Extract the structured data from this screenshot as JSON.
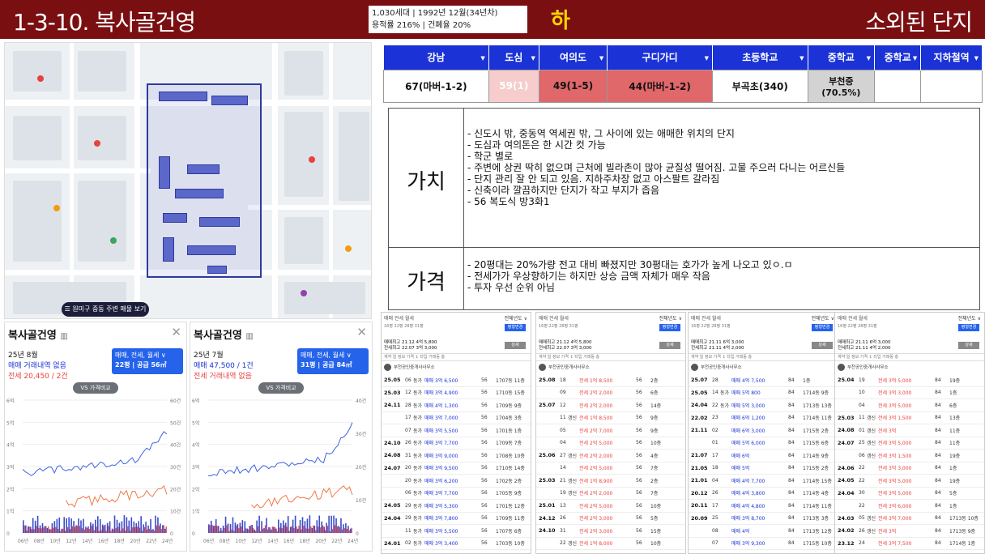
{
  "header": {
    "title": "1-3-10. 복사골건영",
    "info_line1": "1,030세대 | 1992년 12월(34년차)",
    "info_line2": "용적률 216% | 건폐율 20%",
    "grade": "하",
    "tagline": "소외된 단지"
  },
  "map": {
    "button_label": "원미구 중동 주변 매물 보기"
  },
  "score_table": {
    "headers": [
      "강남",
      "도심",
      "여의도",
      "구디가디",
      "초등학교",
      "중학교",
      "중학교",
      "지하철역"
    ],
    "cells": [
      "67(마버-1-2)",
      "59(1)",
      "49(1-5)",
      "44(마버-1-2)",
      "부곡초(340)",
      "부천중\n(70.5%)",
      "",
      ""
    ],
    "colors": [
      "#ffffff",
      "#f6cccc",
      "#e0676a",
      "#e0676a",
      "#ffffff",
      "#d3d3d3",
      "#ffffff",
      "#ffffff"
    ]
  },
  "notes": {
    "value_label": "가치",
    "value_items": [
      "- 신도시 밖, 중동역 역세권 밖, 그 사이에 있는 애매한 위치의 단지",
      "- 도심과 여의돈은 한 시간 컷 가능",
      "- 학군 별로",
      "- 주변에 상권 딱히 없으며 근처에 빌라촌이 많아 균질성 떨어짐. 고물 주으러 다니는 어르신들",
      "- 단지 관리 잘 안 되고 있음. 지하주차장 없고 아스팔트 갈라짐",
      "- 신축이라 깔끔하지만 단지가 작고 부지가 좁음",
      "- 56 복도식 방3화1"
    ],
    "price_label": "가격",
    "price_items": [
      "- 20평대는 20%가량 전고 대비 빠졌지만 30평대는 호가가 높게 나오고 있ㅇ.ㅁ",
      "- 전세가가 우상향하기는 하지만 상승 금액 자체가 매우 작음",
      "- 투자 우선 순위 아님"
    ]
  },
  "charts": [
    {
      "title": "복사골건영",
      "date": "25년 8월",
      "line1": "매매 거래내역 없음",
      "line2": "전세 20,450 / 2건",
      "pill_line1": "매매, 전세, 월세 ∨",
      "pill_line2": "22평 | 공급 56㎡",
      "vs_label": "VS 가격비교",
      "y_left": [
        "6억",
        "5억",
        "4억",
        "3억",
        "2억",
        "1억",
        "0"
      ],
      "y_right": [
        "60건",
        "50건",
        "40건",
        "30건",
        "20건",
        "10건",
        "0"
      ],
      "x_labels": [
        "06년",
        "08년",
        "10년",
        "12년",
        "14년",
        "16년",
        "18년",
        "20년",
        "22년",
        "24년"
      ]
    },
    {
      "title": "복사골건영",
      "date": "25년 7월",
      "line1": "매매 47,500 / 1건",
      "line2": "전세 거래내역 없음",
      "pill_line1": "매매, 전세, 월세 ∨",
      "pill_line2": "31평 | 공급 84㎡",
      "vs_label": "VS 가격비교",
      "y_left": [
        "6억",
        "5억",
        "4억",
        "3억",
        "2억",
        "1억",
        "0"
      ],
      "y_right": [
        "40건",
        "30건",
        "20건",
        "10건",
        "0"
      ],
      "x_labels": [
        "06년",
        "08년",
        "10년",
        "12년",
        "14년",
        "16년",
        "18년",
        "20년",
        "22년",
        "24년"
      ]
    }
  ],
  "transactions": [
    {
      "tabs": "매매  전세  월세",
      "option": "전체년도 ∨",
      "sizes": "16평  22평  28평  31평",
      "summary1": "매매최고 21.12 4억 5,800",
      "summary2": "전세최고 22.07 3억 3,000",
      "btn1": "평형변경",
      "btn2": "상세",
      "header": "계약   일  정보            가격 ↕              타입  거래동  층",
      "agency": "부천공인중개사사무소",
      "rows": [
        [
          "25.05",
          "06",
          "동가",
          "매매 3억 6,500",
          "56",
          "1707동 11층",
          "buy"
        ],
        [
          "25.03",
          "12",
          "동가",
          "매매 3억 4,900",
          "56",
          "1710동 15층",
          "buy"
        ],
        [
          "24.11",
          "28",
          "동가",
          "매매 4억 1,300",
          "56",
          "1709동 9층",
          "buy"
        ],
        [
          "",
          "17",
          "동가",
          "매매 3억 7,000",
          "56",
          "1704동 3층",
          "buy"
        ],
        [
          "",
          "07",
          "동가",
          "매매 3억 5,500",
          "56",
          "1701동 1층",
          "buy"
        ],
        [
          "24.10",
          "26",
          "동가",
          "매매 3억 7,700",
          "56",
          "1709동 7층",
          "buy"
        ],
        [
          "24.08",
          "31",
          "동가",
          "매매 3억 9,000",
          "56",
          "1708동 10층",
          "buy"
        ],
        [
          "24.07",
          "20",
          "동가",
          "매매 3억 9,500",
          "56",
          "1710동 14층",
          "buy"
        ],
        [
          "",
          "20",
          "동가",
          "매매 3억 6,200",
          "56",
          "1702동 2층",
          "buy"
        ],
        [
          "",
          "06",
          "동가",
          "매매 3억 7,700",
          "56",
          "1705동 9층",
          "buy"
        ],
        [
          "24.05",
          "29",
          "동가",
          "매매 3억 5,300",
          "56",
          "1701동 12층",
          "buy"
        ],
        [
          "24.04",
          "29",
          "동가",
          "매매 3억 7,800",
          "56",
          "1709동 11층",
          "buy"
        ],
        [
          "",
          "11",
          "동가",
          "매매 3억 5,500",
          "56",
          "1707동 6층",
          "buy"
        ],
        [
          "24.01",
          "02",
          "동가",
          "매매 3억 3,400",
          "56",
          "1703동 10층",
          "buy"
        ],
        [
          "23.11",
          "25",
          "동가",
          "매매 3억 3,000",
          "56",
          "1710동 3층",
          "buy"
        ],
        [
          "",
          "16",
          "동가",
          "매매 3억 5,000",
          "56",
          "1707동 5층",
          "buy"
        ]
      ]
    },
    {
      "tabs": "매매  전세  월세",
      "option": "전체년도 ∨",
      "sizes": "16평  22평  28평  31평",
      "summary1": "매매최고 21.12 4억 5,800",
      "summary2": "전세최고 22.07 3억 3,000",
      "btn1": "평형변경",
      "btn2": "상세",
      "header": "계약   일  정보            가격 ↕              타입  거래동  층",
      "agency": "부천공인중개사사무소",
      "rows": [
        [
          "25.08",
          "18",
          "",
          "전세 1억 8,500",
          "56",
          "2층",
          "rent"
        ],
        [
          "",
          "09",
          "",
          "전세 2억 2,000",
          "56",
          "6층",
          "rent"
        ],
        [
          "25.07",
          "12",
          "",
          "전세 2억 2,000",
          "56",
          "14층",
          "rent"
        ],
        [
          "",
          "11",
          "갱신",
          "전세 1억 8,500",
          "56",
          "9층",
          "rent"
        ],
        [
          "",
          "05",
          "",
          "전세 2억 7,000",
          "56",
          "9층",
          "rent"
        ],
        [
          "",
          "04",
          "",
          "전세 2억 5,000",
          "56",
          "10층",
          "rent"
        ],
        [
          "25.06",
          "27",
          "갱신",
          "전세 2억 2,000",
          "56",
          "4층",
          "rent"
        ],
        [
          "",
          "14",
          "",
          "전세 2억 5,000",
          "56",
          "7층",
          "rent"
        ],
        [
          "25.03",
          "21",
          "갱신",
          "전세 1억 8,900",
          "56",
          "2층",
          "rent"
        ],
        [
          "",
          "19",
          "갱신",
          "전세 2억 2,000",
          "56",
          "7층",
          "rent"
        ],
        [
          "25.01",
          "13",
          "",
          "전세 2억 5,000",
          "56",
          "10층",
          "rent"
        ],
        [
          "24.12",
          "26",
          "",
          "전세 2억 3,000",
          "56",
          "5층",
          "rent"
        ],
        [
          "24.10",
          "31",
          "",
          "전세 2억 3,000",
          "56",
          "15층",
          "rent"
        ],
        [
          "",
          "22",
          "갱신",
          "전세 1억 8,000",
          "56",
          "10층",
          "rent"
        ],
        [
          "24.09",
          "20",
          "갱신",
          "전세 2억 9,000",
          "56",
          "10층",
          "rent"
        ],
        [
          "24.08",
          "29",
          "",
          "전세 2억 6,000",
          "56",
          "14층",
          "rent"
        ]
      ]
    },
    {
      "tabs": "매매  전세  월세",
      "option": "전체년도 ∨",
      "sizes": "16평  22평  28평  31평",
      "summary1": "매매최고 21.11 6억 3,000",
      "summary2": "전세최고 21.11 4억 2,000",
      "btn1": "평형변경",
      "btn2": "상세",
      "header": "계약   일  정보            가격 ↕              타입  거래동  층",
      "agency": "부천공인중개사사무소",
      "rows": [
        [
          "25.07",
          "28",
          "",
          "매매 4억 7,500",
          "84",
          "1층",
          "buy"
        ],
        [
          "25.05",
          "14",
          "동가",
          "매매 5억 800",
          "84",
          "1714동 9층",
          "buy"
        ],
        [
          "24.04",
          "22",
          "동가",
          "매매 5억 3,000",
          "84",
          "1713동 13층",
          "buy"
        ],
        [
          "22.02",
          "23",
          "",
          "매매 6억 1,200",
          "84",
          "1714동 11층",
          "buy"
        ],
        [
          "21.11",
          "02",
          "",
          "매매 6억 3,000",
          "84",
          "1715동 2층",
          "buy"
        ],
        [
          "",
          "01",
          "",
          "매매 5억 6,000",
          "84",
          "1715동 6층",
          "buy"
        ],
        [
          "21.07",
          "17",
          "",
          "매매 6억",
          "84",
          "1714동 9층",
          "buy"
        ],
        [
          "21.05",
          "18",
          "",
          "매매 5억",
          "84",
          "1715동 2층",
          "buy"
        ],
        [
          "21.01",
          "04",
          "",
          "매매 4억 7,700",
          "84",
          "1714동 15층",
          "buy"
        ],
        [
          "20.12",
          "26",
          "",
          "매매 4억 3,800",
          "84",
          "1714동 4층",
          "buy"
        ],
        [
          "20.11",
          "17",
          "",
          "매매 4억 4,800",
          "84",
          "1714동 11층",
          "buy"
        ],
        [
          "20.09",
          "25",
          "",
          "매매 3억 8,700",
          "84",
          "1713동 3층",
          "buy"
        ],
        [
          "",
          "08",
          "",
          "매매 4억",
          "84",
          "1713동 12층",
          "buy"
        ],
        [
          "",
          "07",
          "",
          "매매 3억 9,300",
          "84",
          "1715동 10층",
          "buy"
        ],
        [
          "20.08",
          "15",
          "",
          "매매 4억 750",
          "84",
          "1714동 9층",
          "buy"
        ],
        [
          "20.07",
          "03",
          "",
          "매매 3억 8,500",
          "84",
          "1715동 2층",
          "buy"
        ]
      ]
    },
    {
      "tabs": "매매  전세  월세",
      "option": "전체년도 ∨",
      "sizes": "16평  22평  28평  31평",
      "summary1": "매매최고 21.11 6억 3,000",
      "summary2": "전세최고 21.11 4억 2,000",
      "btn1": "평형변경",
      "btn2": "상세",
      "header": "계약   일  정보            가격 ↕              타입  거래동  층",
      "agency": "부천공인중개사사무소",
      "rows": [
        [
          "25.04",
          "19",
          "",
          "전세 3억 5,000",
          "84",
          "19층",
          "rent"
        ],
        [
          "",
          "10",
          "",
          "전세 3억 3,000",
          "84",
          "1층",
          "rent"
        ],
        [
          "",
          "04",
          "",
          "전세 3억 5,000",
          "84",
          "6층",
          "rent"
        ],
        [
          "25.03",
          "11",
          "갱신",
          "전세 3억 1,500",
          "84",
          "13층",
          "rent"
        ],
        [
          "24.08",
          "01",
          "갱신",
          "전세 3억",
          "84",
          "11층",
          "rent"
        ],
        [
          "24.07",
          "25",
          "갱신",
          "전세 3억 5,000",
          "84",
          "11층",
          "rent"
        ],
        [
          "",
          "06",
          "갱신",
          "전세 3억 1,500",
          "84",
          "19층",
          "rent"
        ],
        [
          "24.06",
          "22",
          "",
          "전세 3억 3,000",
          "84",
          "1층",
          "rent"
        ],
        [
          "24.05",
          "22",
          "",
          "전세 3억 5,000",
          "84",
          "19층",
          "rent"
        ],
        [
          "24.04",
          "30",
          "",
          "전세 3억 5,000",
          "84",
          "5층",
          "rent"
        ],
        [
          "",
          "22",
          "",
          "전세 3억 6,000",
          "84",
          "1층",
          "rent"
        ],
        [
          "24.03",
          "05",
          "갱신",
          "전세 3억 7,000",
          "84",
          "1713동 10층",
          "rent"
        ],
        [
          "24.02",
          "26",
          "갱신",
          "전세 3억",
          "84",
          "1713동 9층",
          "rent"
        ],
        [
          "23.12",
          "24",
          "",
          "전세 3억 7,500",
          "84",
          "1714동 1층",
          "rent"
        ],
        [
          "23.03",
          "19",
          "",
          "전세 3억",
          "84",
          "1715동 10층",
          "rent"
        ],
        [
          "",
          "08",
          "",
          "전세 2억 8,500",
          "84",
          "1714동 7층",
          "rent"
        ]
      ]
    }
  ]
}
